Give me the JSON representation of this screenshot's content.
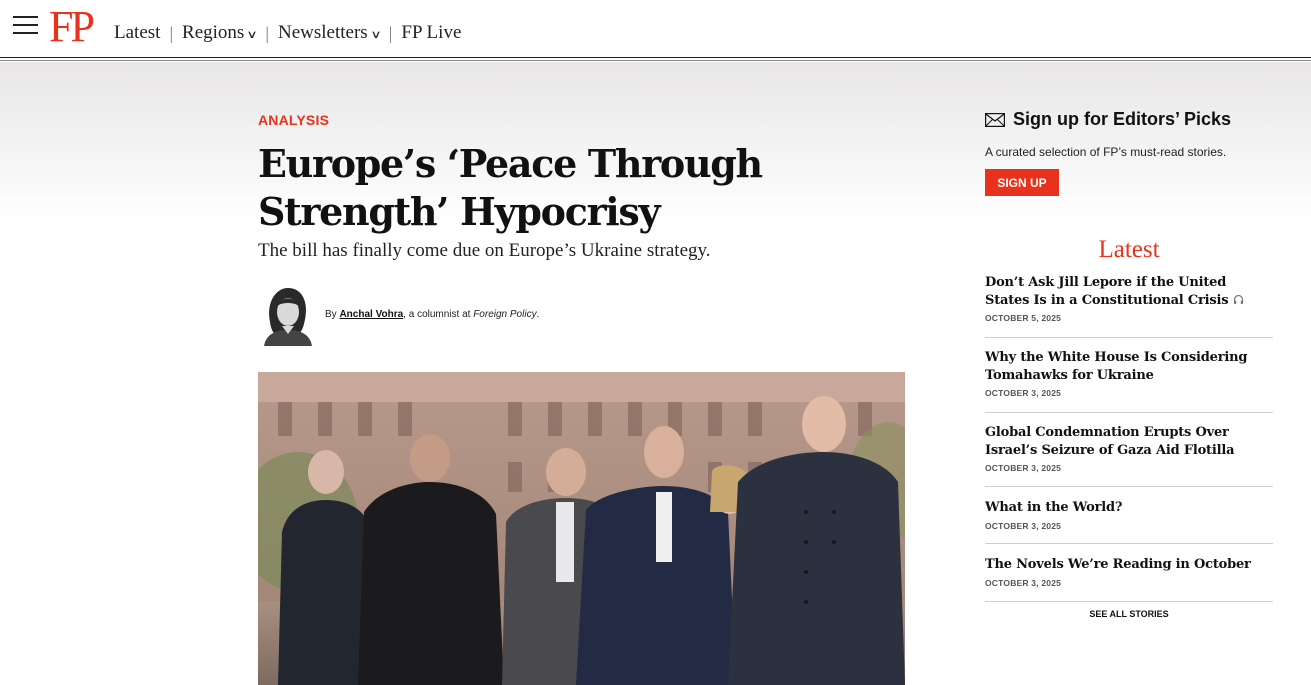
{
  "header": {
    "logo": "FP",
    "nav": [
      {
        "label": "Latest"
      },
      {
        "label": "Regions"
      },
      {
        "label": "Newsletters"
      },
      {
        "label": "FP Live"
      }
    ]
  },
  "article": {
    "kicker": "ANALYSIS",
    "headline": "Europe’s ‘Peace Through Strength’ Hypocrisy",
    "dek": "The bill has finally come due on Europe’s Ukraine strategy.",
    "byline": {
      "prefix": "By ",
      "author": "Anchal Vohra",
      "middle": ", a columnist at ",
      "publication": "Foreign Policy",
      "suffix": "."
    }
  },
  "sidebar": {
    "signup": {
      "title": "Sign up for Editors’ Picks",
      "description": "A curated selection of FP’s must-read stories.",
      "button": "SIGN UP"
    },
    "latest": {
      "title": "Latest",
      "stories": [
        {
          "title": "Don’t Ask Jill Lepore if the United States Is in a Constitutional Crisis",
          "date": "OCTOBER 5, 2025",
          "has_audio": true
        },
        {
          "title": "Why the White House Is Considering Tomahawks for Ukraine",
          "date": "OCTOBER 3, 2025"
        },
        {
          "title": "Global Condemnation Erupts Over Israel’s Seizure of Gaza Aid Flotilla",
          "date": "OCTOBER 3, 2025"
        },
        {
          "title": "What in the World?",
          "date": "OCTOBER 3, 2025"
        },
        {
          "title": "The Novels We’re Reading in October",
          "date": "OCTOBER 3, 2025"
        }
      ],
      "see_all": "SEE ALL STORIES"
    }
  },
  "colors": {
    "brand": "#e8321d",
    "text": "#111111"
  },
  "icons": {
    "menu": "hamburger-icon",
    "dropdown": "chevron-down-icon",
    "email": "envelope-icon",
    "audio": "headphones-icon"
  }
}
